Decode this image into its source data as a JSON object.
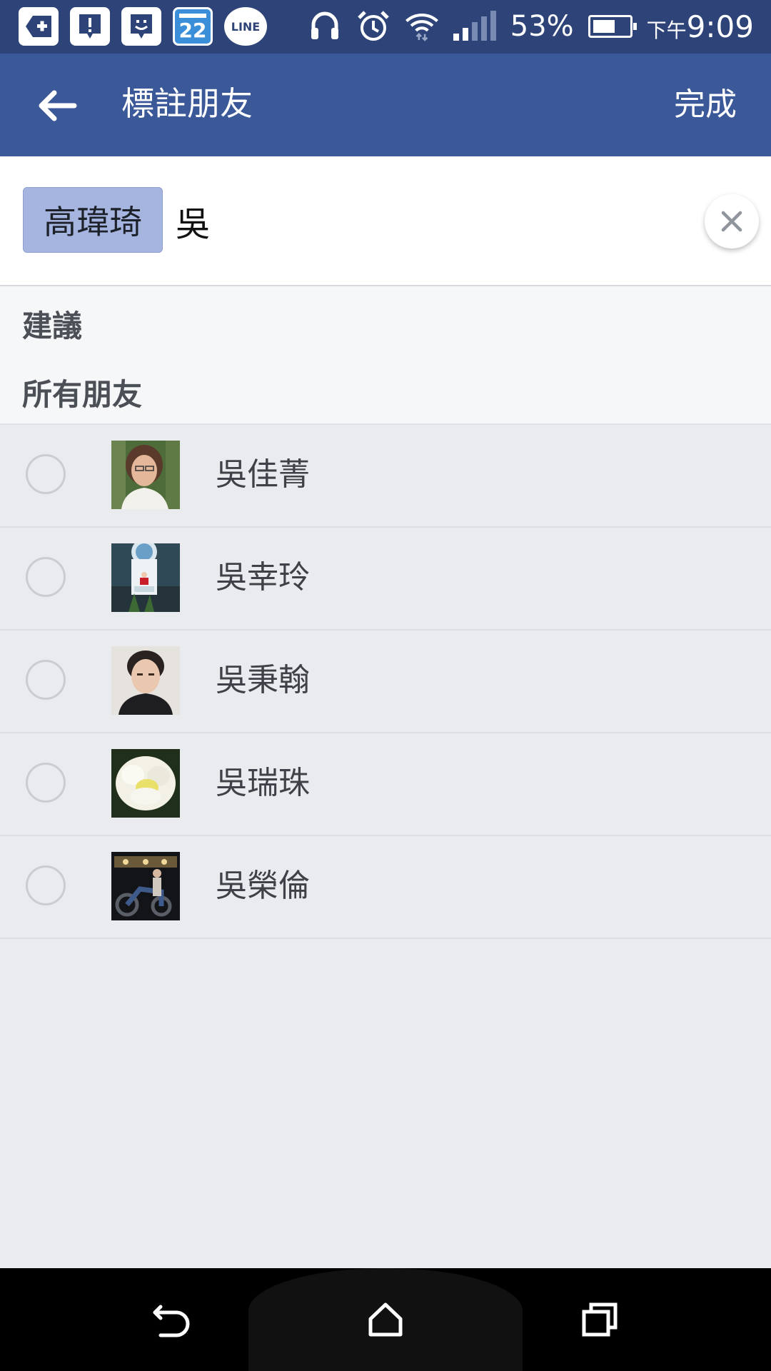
{
  "status_bar": {
    "calendar_day": "22",
    "line_label": "LINE",
    "battery_pct": "53%",
    "ampm": "下午",
    "time": "9:09",
    "icons": [
      "add-notification-icon",
      "alert-icon",
      "messenger-icon",
      "calendar-icon",
      "line-icon",
      "headset-icon",
      "alarm-icon",
      "wifi-icon",
      "signal-icon",
      "battery-icon"
    ]
  },
  "app_bar": {
    "title": "標註朋友",
    "done_label": "完成"
  },
  "token_field": {
    "selected_chip": "高瑋琦",
    "query": "吳"
  },
  "sections": {
    "suggested": "建議",
    "all_friends": "所有朋友"
  },
  "friends": [
    {
      "name": "吳佳菁"
    },
    {
      "name": "吳幸玲"
    },
    {
      "name": "吳秉翰"
    },
    {
      "name": "吳瑞珠"
    },
    {
      "name": "吳榮倫"
    }
  ],
  "colors": {
    "status_bar": "#2e4478",
    "app_bar": "#3b5998",
    "chip": "#a5b5e0",
    "background": "#e9ebee"
  }
}
